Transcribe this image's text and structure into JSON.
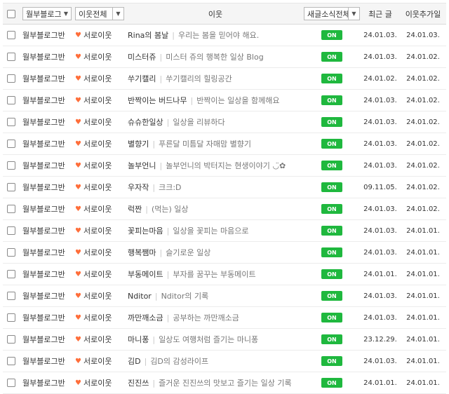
{
  "header": {
    "group_select": "월부블로그...",
    "type_select": "이웃전체",
    "neighbor_label": "이웃",
    "alarm_select": "새글소식전체",
    "recent_label": "최근 글",
    "added_label": "이웃추가일"
  },
  "rows": [
    {
      "group": "월부블로그반",
      "type": "서로이웃",
      "name": "Rina의 봄날",
      "desc": "우리는 봄을 믿어야 해요.",
      "alarm": "ON",
      "recent": "24.01.03.",
      "added": "24.01.03."
    },
    {
      "group": "월부블로그반",
      "type": "서로이웃",
      "name": "미스터쥬",
      "desc": "미스터 쥬의 행복한 일상 Blog",
      "alarm": "ON",
      "recent": "24.01.03.",
      "added": "24.01.02."
    },
    {
      "group": "월부블로그반",
      "type": "서로이웃",
      "name": "쑤기캘리",
      "desc": "쑤기캘리의 힐링공간",
      "alarm": "ON",
      "recent": "24.01.02.",
      "added": "24.01.02."
    },
    {
      "group": "월부블로그반",
      "type": "서로이웃",
      "name": "반짝이는 버드나무",
      "desc": "반짝이는 일상을 함께해요",
      "alarm": "ON",
      "recent": "24.01.03.",
      "added": "24.01.02."
    },
    {
      "group": "월부블로그반",
      "type": "서로이웃",
      "name": "슈슈한일상",
      "desc": "일상을 리뷰하다",
      "alarm": "ON",
      "recent": "24.01.03.",
      "added": "24.01.02."
    },
    {
      "group": "월부블로그반",
      "type": "서로이웃",
      "name": "별향기",
      "desc": "푸른달 미틈달 자매맘 별향기",
      "alarm": "ON",
      "recent": "24.01.03.",
      "added": "24.01.02."
    },
    {
      "group": "월부블로그반",
      "type": "서로이웃",
      "name": "놀부언니",
      "desc": "놀부언니의 박터지는 현생이야기 ◡̈✿",
      "alarm": "ON",
      "recent": "24.01.03.",
      "added": "24.01.02."
    },
    {
      "group": "월부블로그반",
      "type": "서로이웃",
      "name": "우자작",
      "desc": "크크:D",
      "alarm": "ON",
      "recent": "09.11.05.",
      "added": "24.01.02."
    },
    {
      "group": "월부블로그반",
      "type": "서로이웃",
      "name": "럭짠",
      "desc": "(먹는) 일상",
      "alarm": "ON",
      "recent": "24.01.03.",
      "added": "24.01.02."
    },
    {
      "group": "월부블로그반",
      "type": "서로이웃",
      "name": "꽃피는마음",
      "desc": "일상을 꽃피는 마음으로",
      "alarm": "ON",
      "recent": "24.01.03.",
      "added": "24.01.01."
    },
    {
      "group": "월부블로그반",
      "type": "서로이웃",
      "name": "행복쨈마",
      "desc": "슬기로운 일상",
      "alarm": "ON",
      "recent": "24.01.03.",
      "added": "24.01.01."
    },
    {
      "group": "월부블로그반",
      "type": "서로이웃",
      "name": "부동메이트",
      "desc": "부자를 꿈꾸는 부동메이트",
      "alarm": "ON",
      "recent": "24.01.01.",
      "added": "24.01.01."
    },
    {
      "group": "월부블로그반",
      "type": "서로이웃",
      "name": "Nditor",
      "desc": "Nditor의 기록",
      "alarm": "ON",
      "recent": "24.01.03.",
      "added": "24.01.01."
    },
    {
      "group": "월부블로그반",
      "type": "서로이웃",
      "name": "까만깨소금",
      "desc": "공부하는 까만깨소금",
      "alarm": "ON",
      "recent": "24.01.03.",
      "added": "24.01.01."
    },
    {
      "group": "월부블로그반",
      "type": "서로이웃",
      "name": "마니퐁",
      "desc": "일상도 여행처럼 즐기는 마니퐁",
      "alarm": "ON",
      "recent": "23.12.29.",
      "added": "24.01.01."
    },
    {
      "group": "월부블로그반",
      "type": "서로이웃",
      "name": "김D",
      "desc": "김D의 감성라이프",
      "alarm": "ON",
      "recent": "24.01.03.",
      "added": "24.01.01."
    },
    {
      "group": "월부블로그반",
      "type": "서로이웃",
      "name": "진진쓰",
      "desc": "즐거운 진진쓰의 맛보고 즐기는 일상 기록",
      "alarm": "ON",
      "recent": "24.01.01.",
      "added": "24.01.01."
    }
  ],
  "colors": {
    "on_badge": "#1fb83e",
    "heart": "#ff6e3a"
  },
  "icons": {
    "dropdown": "chevron-down-icon",
    "type_marker": "heart-icon"
  }
}
